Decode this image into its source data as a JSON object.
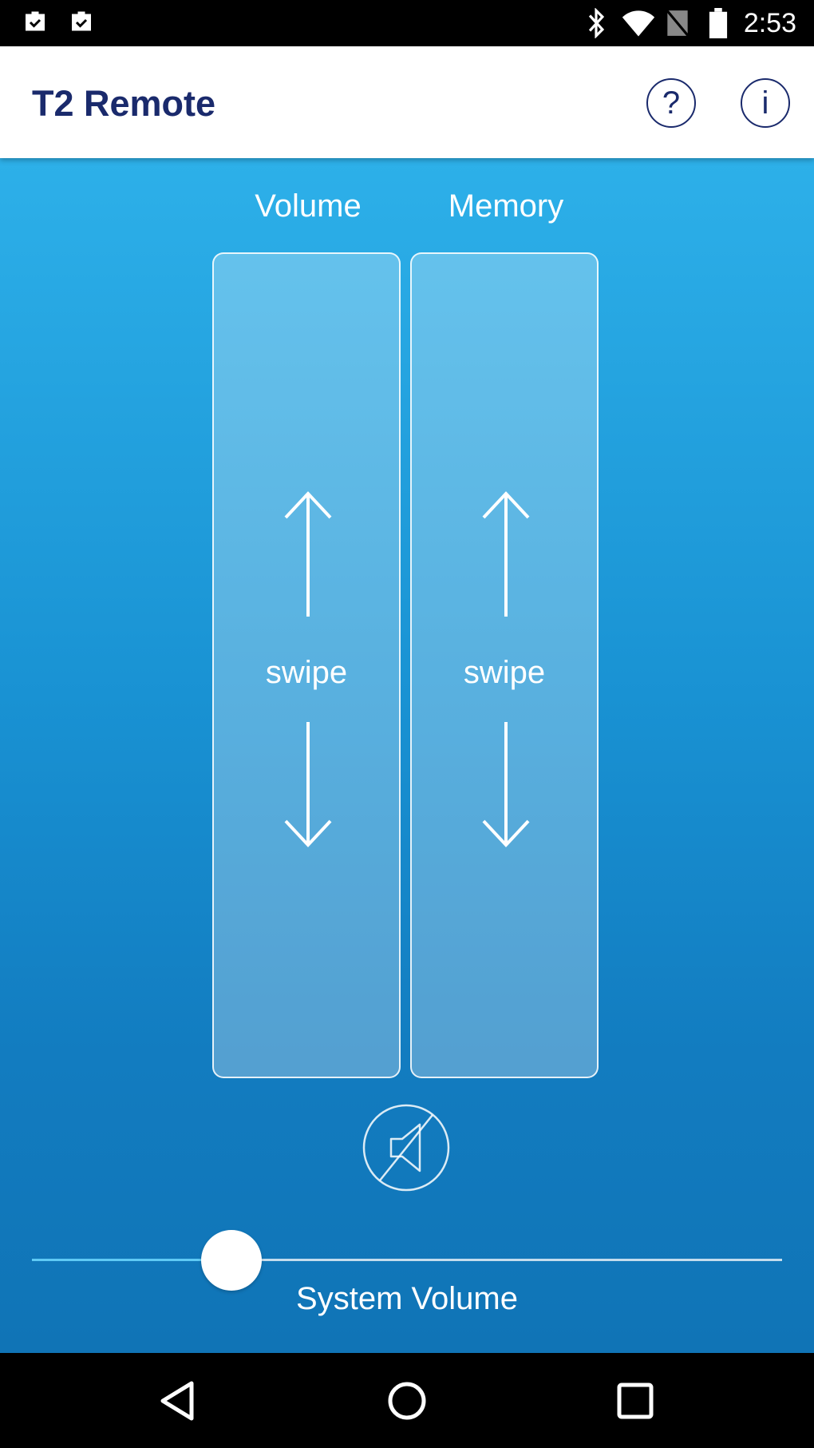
{
  "status_bar": {
    "time": "2:53",
    "left_icons": [
      "work-check-icon",
      "work-check-icon"
    ],
    "right_icons": [
      "bluetooth-icon",
      "wifi-icon",
      "no-sim-icon",
      "battery-icon"
    ]
  },
  "app_bar": {
    "title": "T2 Remote",
    "help_label": "?",
    "info_label": "i"
  },
  "controls": {
    "volume_label": "Volume",
    "memory_label": "Memory",
    "volume_swipe": "swipe",
    "memory_swipe": "swipe",
    "mute_icon": "speaker-mute-icon"
  },
  "system_volume": {
    "label": "System Volume",
    "level": 0.266
  },
  "nav_bar": {
    "icons": [
      "back-icon",
      "home-icon",
      "recents-icon"
    ]
  },
  "colors": {
    "title": "#1a2a6c",
    "gradient_top": "#2db0e9",
    "gradient_bottom": "#1074b6",
    "slider_fill": "#5fcaf5"
  }
}
